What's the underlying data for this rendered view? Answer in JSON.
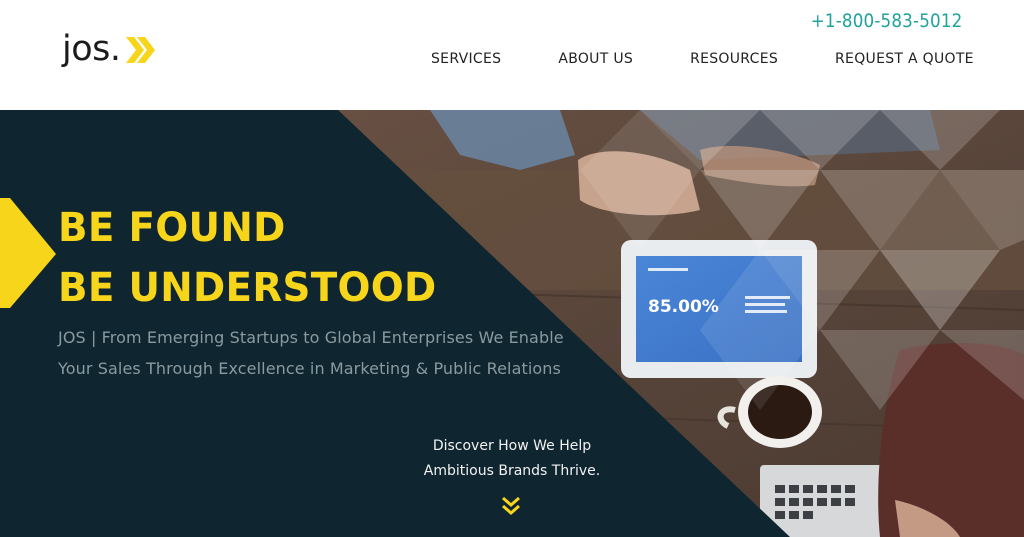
{
  "header": {
    "logo_text": "jos.",
    "phone": "+1-800-583-5012",
    "nav": [
      {
        "label": "SERVICES"
      },
      {
        "label": "ABOUT US"
      },
      {
        "label": "RESOURCES"
      },
      {
        "label": "REQUEST A QUOTE"
      }
    ]
  },
  "hero": {
    "headline_line1": "BE FOUND",
    "headline_line2": "BE UNDERSTOOD",
    "subtitle_line1": "JOS | From Emerging Startups to Global Enterprises We Enable",
    "subtitle_line2": "Your Sales Through Excellence in Marketing & Public Relations",
    "discover_line1": "Discover How We Help",
    "discover_line2": "Ambitious Brands Thrive.",
    "tablet_stat": "85.00%"
  },
  "colors": {
    "brand_yellow": "#f6d51b",
    "phone_teal": "#1fa39a",
    "hero_dark": "#0f2530",
    "nav_text": "#222222"
  },
  "icons": {
    "logo": "double-chevron-right-icon",
    "scroll": "double-chevron-down-icon",
    "side_tab": "yellow-arrow-tab-icon"
  }
}
